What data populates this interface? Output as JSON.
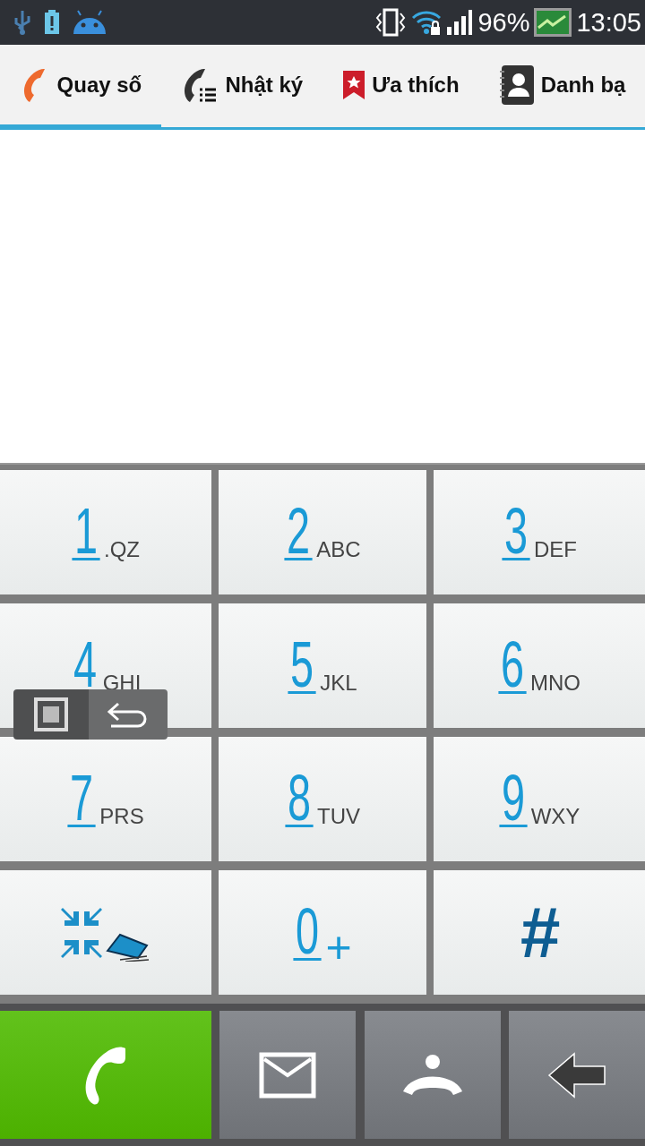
{
  "status_bar": {
    "battery_percent": "96%",
    "time": "13:05"
  },
  "tabs": [
    {
      "label": "Quay số",
      "selected": true
    },
    {
      "label": "Nhật ký",
      "selected": false
    },
    {
      "label": "Ưa thích",
      "selected": false
    },
    {
      "label": "Danh bạ",
      "selected": false
    }
  ],
  "keypad": [
    {
      "kind": "digit",
      "digit": "1",
      "letters": ".QZ"
    },
    {
      "kind": "digit",
      "digit": "2",
      "letters": "ABC"
    },
    {
      "kind": "digit",
      "digit": "3",
      "letters": "DEF"
    },
    {
      "kind": "digit",
      "digit": "4",
      "letters": "GHI"
    },
    {
      "kind": "digit",
      "digit": "5",
      "letters": "JKL"
    },
    {
      "kind": "digit",
      "digit": "6",
      "letters": "MNO"
    },
    {
      "kind": "digit",
      "digit": "7",
      "letters": "PRS"
    },
    {
      "kind": "digit",
      "digit": "8",
      "letters": "TUV"
    },
    {
      "kind": "digit",
      "digit": "9",
      "letters": "WXY"
    },
    {
      "kind": "icon"
    },
    {
      "kind": "digit",
      "digit": "0",
      "letters": "+"
    },
    {
      "kind": "symbol",
      "symbol": "#"
    }
  ]
}
